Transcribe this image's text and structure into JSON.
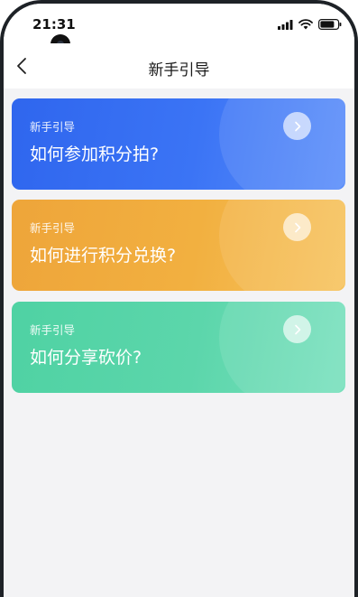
{
  "status_bar": {
    "time": "21:31",
    "icons": [
      "signal-icon",
      "wifi-icon",
      "battery-icon"
    ]
  },
  "nav": {
    "back_icon": "chevron-left-icon",
    "title": "新手引导"
  },
  "cards": [
    {
      "eyebrow": "新手引导",
      "question": "如何参加积分拍?",
      "color": "#3b74f5",
      "icon": "chevron-right-icon"
    },
    {
      "eyebrow": "新手引导",
      "question": "如何进行积分兑换?",
      "color": "#f2b040",
      "icon": "chevron-right-icon"
    },
    {
      "eyebrow": "新手引导",
      "question": "如何分享砍价?",
      "color": "#5cd6ab",
      "icon": "chevron-right-icon"
    }
  ]
}
